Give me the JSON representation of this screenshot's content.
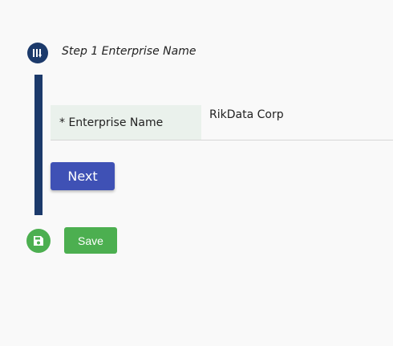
{
  "colors": {
    "step_accent": "#1c3a6b",
    "label_background": "#eaf1ec",
    "next_button": "#3f51b5",
    "save_green": "#4caf50",
    "page_background": "#f9f9f9"
  },
  "step": {
    "icon": "step-list-icon",
    "title": "Step 1 Enterprise Name"
  },
  "form": {
    "fields": [
      {
        "label": "* Enterprise Name",
        "value": "RikData Corp"
      }
    ]
  },
  "actions": {
    "next_label": "Next",
    "save_icon": "save-floppy-icon",
    "save_label": "Save"
  }
}
